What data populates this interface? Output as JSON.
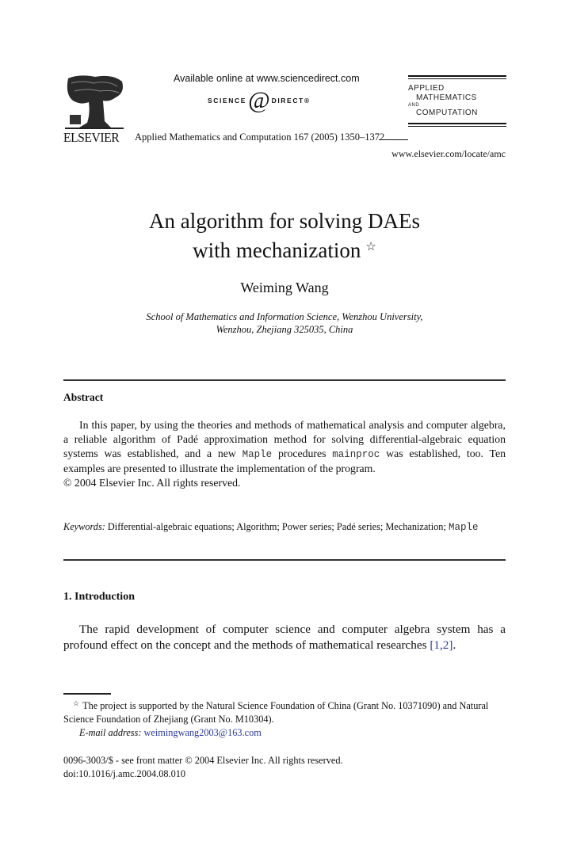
{
  "header": {
    "publisher_name": "ELSEVIER",
    "available_online": "Available online at www.sciencedirect.com",
    "sciencedirect_logo": {
      "left": "SCIENCE",
      "mark": "d",
      "right": "DIRECT®"
    },
    "journal_citation": "Applied Mathematics and Computation 167 (2005) 1350–1372",
    "journal_logo_lines": [
      "APPLIED",
      "MATHEMATICS",
      "AND",
      "COMPUTATION"
    ],
    "journal_url": "www.elsevier.com/locate/amc"
  },
  "article": {
    "title_line1": "An algorithm for solving DAEs",
    "title_line2": "with mechanization",
    "title_footnote_marker": "☆",
    "author": "Weiming Wang",
    "affiliation_line1": "School of Mathematics and Information Science, Wenzhou University,",
    "affiliation_line2": "Wenzhou, Zhejiang 325035, China"
  },
  "abstract": {
    "heading": "Abstract",
    "text_part1": "In this paper, by using the theories and methods of mathematical analysis and computer algebra, a reliable algorithm of Padé approximation method for solving differential-algebraic equation systems was established, and a new ",
    "code1": "Maple",
    "text_part2": " procedures ",
    "code2": "mainproc",
    "text_part3": " was established, too. Ten examples are presented to illustrate the implementation of the program.",
    "copyright": "© 2004 Elsevier Inc. All rights reserved."
  },
  "keywords": {
    "label": "Keywords:",
    "text": " Differential-algebraic equations; Algorithm; Power series; Padé series; Mechanization; ",
    "code": "Maple"
  },
  "introduction": {
    "heading": "1. Introduction",
    "text": "The rapid development of computer science and computer algebra system has a profound effect on the concept and the methods of mathematical researches ",
    "citation": "[1,2]",
    "end": "."
  },
  "footnote": {
    "marker": "☆",
    "text": "The project is supported by the Natural Science Foundation of China (Grant No. 10371090) and Natural Science Foundation of Zhejiang (Grant No. M10304).",
    "email_label": "E-mail address:",
    "email": "weimingwang2003@163.com"
  },
  "front_matter": {
    "issn_line": "0096-3003/$ - see front matter  © 2004 Elsevier Inc. All rights reserved.",
    "doi": "doi:10.1016/j.amc.2004.08.010"
  }
}
